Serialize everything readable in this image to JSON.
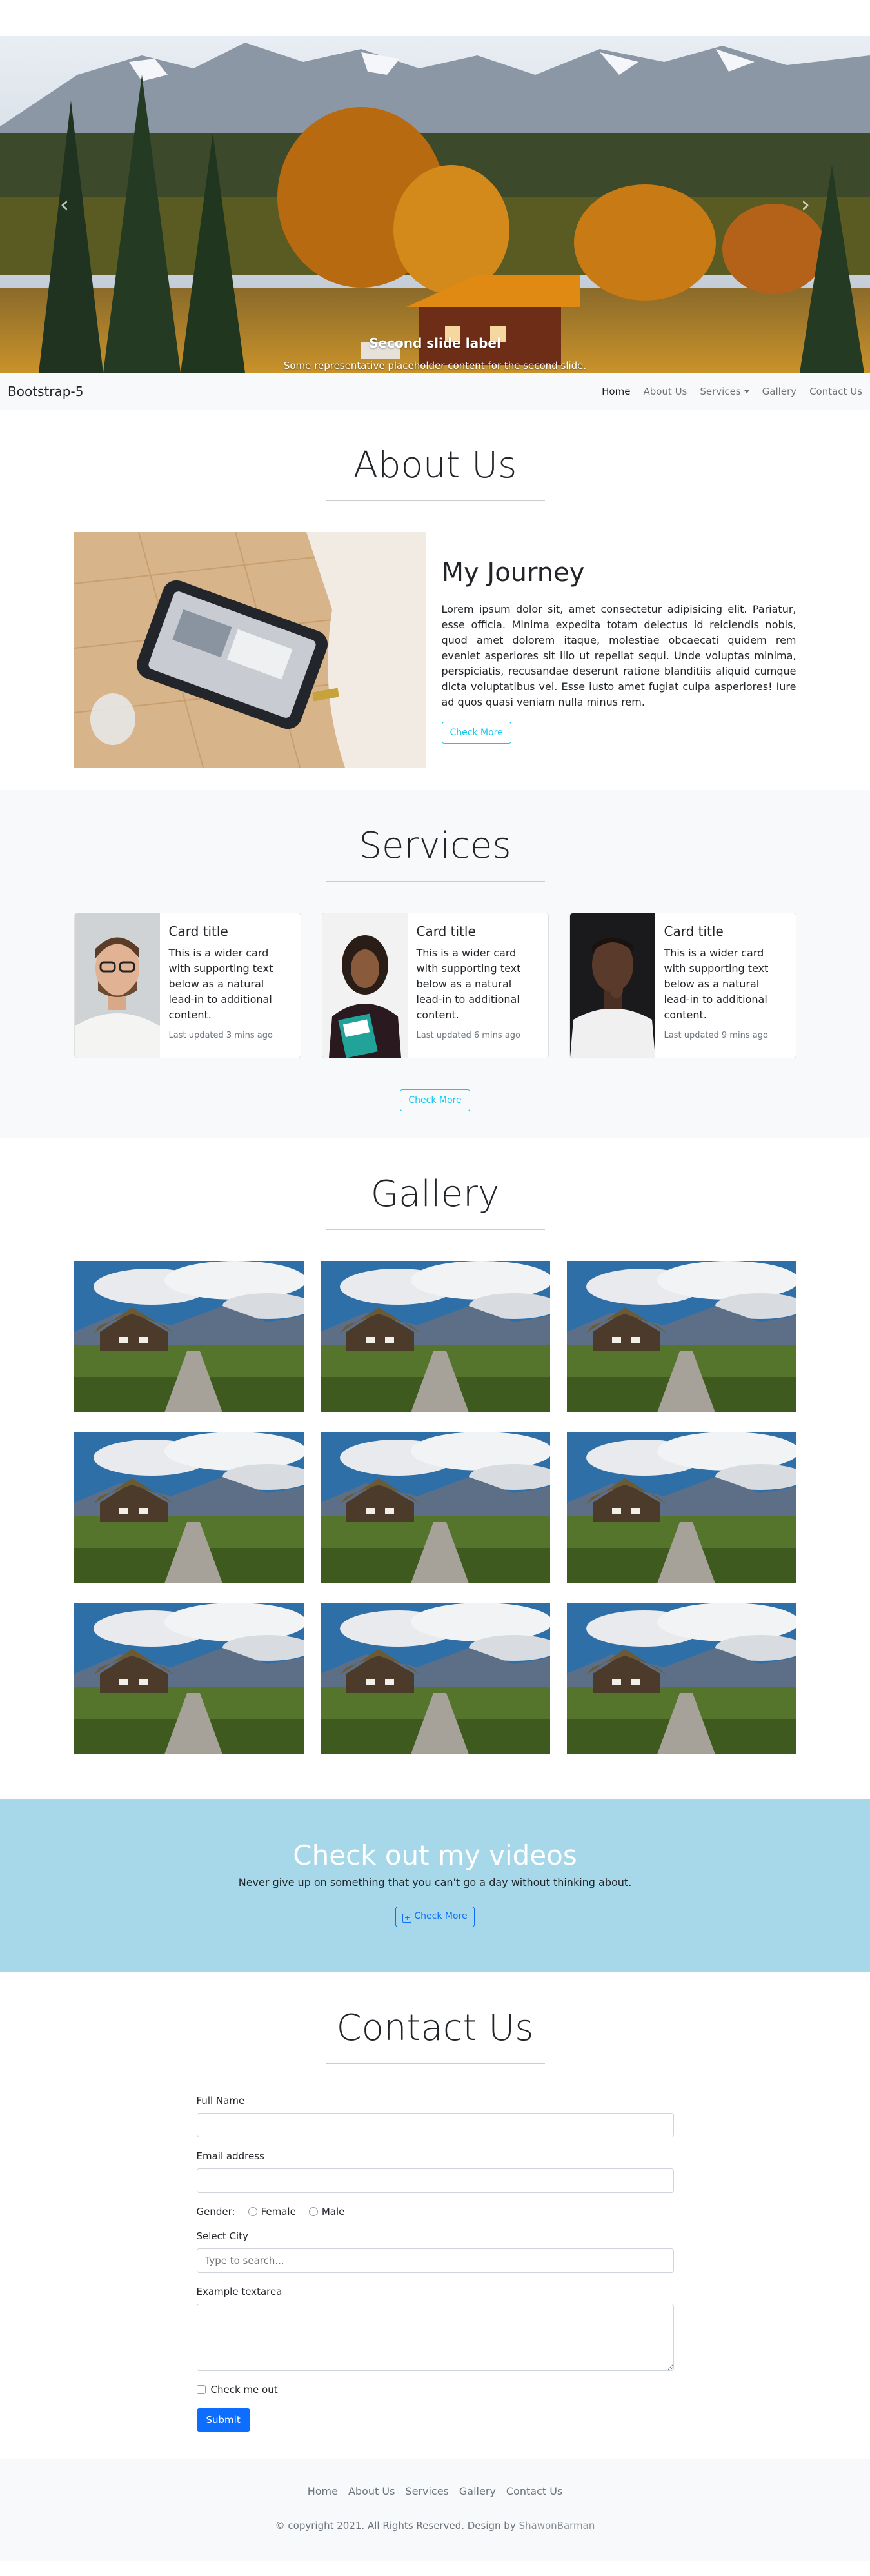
{
  "carousel": {
    "caption_title": "Second slide label",
    "caption_text": "Some representative placeholder content for the second slide.",
    "prev_icon": "chevron-left-icon",
    "next_icon": "chevron-right-icon"
  },
  "navbar": {
    "brand": "Bootstrap-5",
    "links": [
      "Home",
      "About Us",
      "Services",
      "Gallery",
      "Contact Us"
    ]
  },
  "about": {
    "title": "About Us",
    "heading": "My Journey",
    "text": "Lorem ipsum dolor sit, amet consectetur adipisicing elit. Pariatur, esse officia. Minima expedita totam delectus id reiciendis nobis, quod amet dolorem itaque, molestiae obcaecati quidem rem eveniet asperiores sit illo ut repellat sequi. Unde voluptas minima, perspiciatis, recusandae deserunt ratione blanditiis aliquid cumque dicta voluptatibus vel. Esse iusto amet fugiat culpa asperiores! Iure ad quos quasi veniam nulla minus rem.",
    "button": "Check More"
  },
  "services": {
    "title": "Services",
    "cards": [
      {
        "title": "Card title",
        "text": "This is a wider card with supporting text below as a natural lead-in to additional content.",
        "updated": "Last updated 3 mins ago"
      },
      {
        "title": "Card title",
        "text": "This is a wider card with supporting text below as a natural lead-in to additional content.",
        "updated": "Last updated 6 mins ago"
      },
      {
        "title": "Card title",
        "text": "This is a wider card with supporting text below as a natural lead-in to additional content.",
        "updated": "Last updated 9 mins ago"
      }
    ],
    "button": "Check More"
  },
  "gallery": {
    "title": "Gallery"
  },
  "videos": {
    "title": "Check out my videos",
    "text": "Never give up on something that you can't go a day without thinking about.",
    "button": "Check More",
    "button_icon": "plus-square-icon"
  },
  "contact": {
    "title": "Contact Us",
    "full_name_label": "Full Name",
    "email_label": "Email address",
    "gender_label": "Gender:",
    "female": "Female",
    "male": "Male",
    "city_label": "Select City",
    "city_placeholder": "Type to search...",
    "textarea_label": "Example textarea",
    "check_label": "Check me out",
    "submit": "Submit"
  },
  "footer": {
    "links": [
      "Home",
      "About Us",
      "Services",
      "Gallery",
      "Contact Us"
    ],
    "copyright": "© copyright 2021. All Rights Reserved. Design by ",
    "author": "ShawonBarman"
  },
  "colors": {
    "info": "#0dcaf0",
    "primary": "#0d6efd",
    "videos_bg": "#a6d8ea",
    "light_bg": "#f8f9fa"
  }
}
